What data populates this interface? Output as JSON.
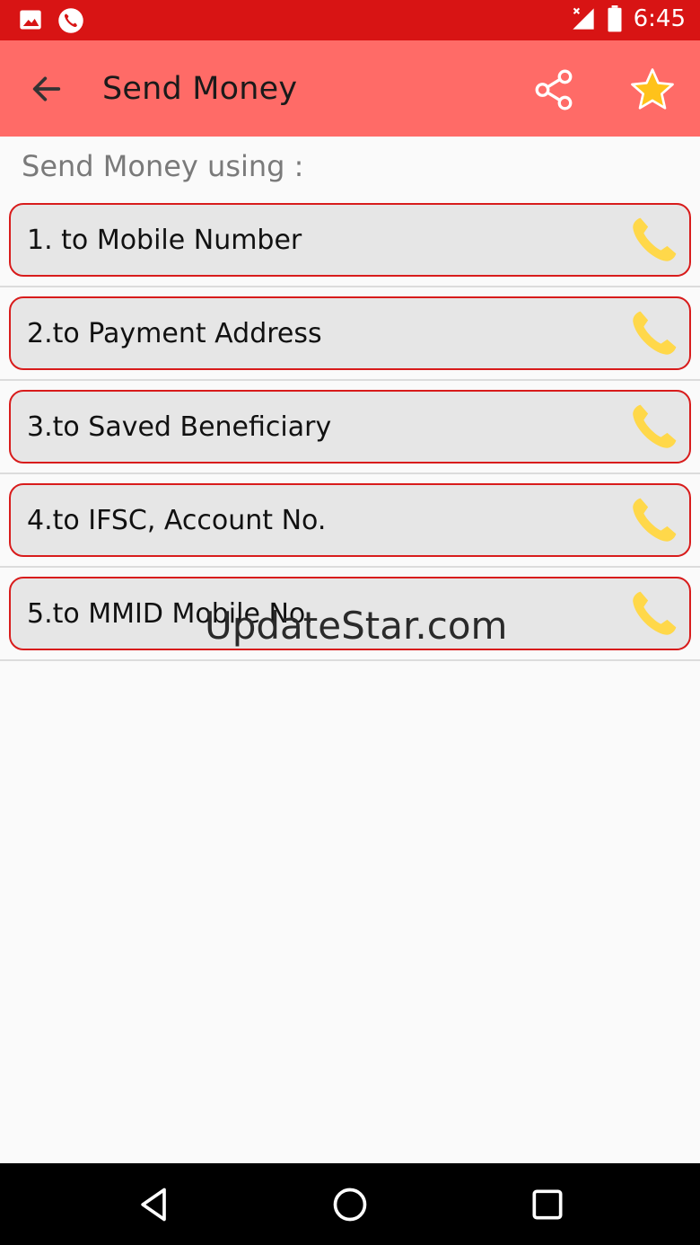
{
  "status_bar": {
    "time": "6:45",
    "icons": [
      "image-icon",
      "phone-call-icon",
      "signal-icon",
      "battery-icon"
    ]
  },
  "app_bar": {
    "title": "Send Money",
    "actions": [
      "share-icon",
      "star-icon"
    ]
  },
  "content": {
    "subheading": "Send Money using :",
    "options": [
      {
        "label": "1. to Mobile Number",
        "icon": "phone-icon"
      },
      {
        "label": "2.to Payment Address",
        "icon": "phone-icon"
      },
      {
        "label": "3.to Saved Beneficiary",
        "icon": "phone-icon"
      },
      {
        "label": "4.to IFSC, Account No.",
        "icon": "phone-icon"
      },
      {
        "label": "5.to MMID Mobile No.",
        "icon": "phone-icon"
      }
    ]
  },
  "watermark": "UpdateStar.com",
  "colors": {
    "status_bar": "#d81414",
    "app_bar": "#ff6b67",
    "card_border": "#d81c1c",
    "card_bg": "#e6e6e6",
    "phone_icon": "#ffd84a"
  },
  "nav_bar": {
    "buttons": [
      "back-triangle-icon",
      "home-circle-icon",
      "recents-square-icon"
    ]
  }
}
